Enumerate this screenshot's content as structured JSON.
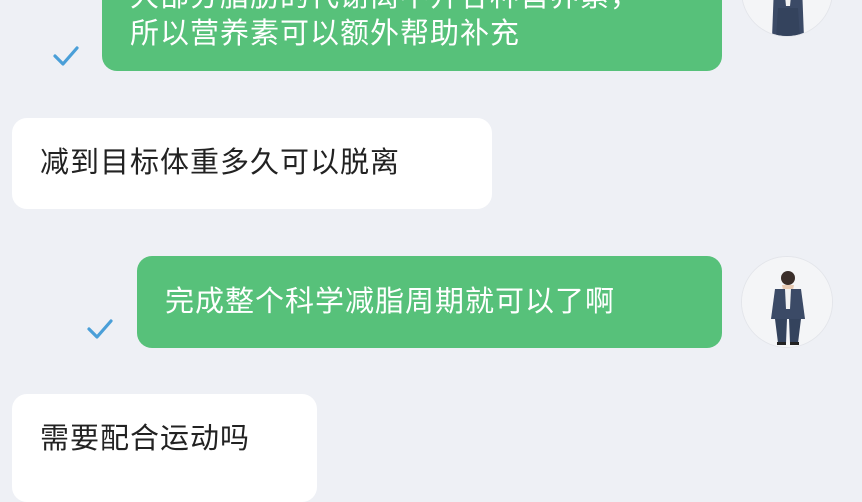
{
  "chat": {
    "messages": [
      {
        "id": "m1",
        "direction": "outgoing",
        "lines": [
          "大部分脂肪的代谢离不开各种营养素，",
          "所以营养素可以额外帮助补充"
        ],
        "read": true
      },
      {
        "id": "m2",
        "direction": "incoming",
        "lines": [
          "减到目标体重多久可以脱离"
        ]
      },
      {
        "id": "m3",
        "direction": "outgoing",
        "lines": [
          "完成整个科学减脂周期就可以了啊"
        ],
        "read": true
      },
      {
        "id": "m4",
        "direction": "incoming",
        "lines": [
          "需要配合运动吗"
        ]
      }
    ],
    "read_icon": "checkmark-icon",
    "avatar_icon": "user-avatar-icon"
  },
  "colors": {
    "background": "#eef0f5",
    "outgoing_bubble": "#57c17a",
    "incoming_bubble": "#ffffff",
    "check": "#4a9fd8"
  }
}
